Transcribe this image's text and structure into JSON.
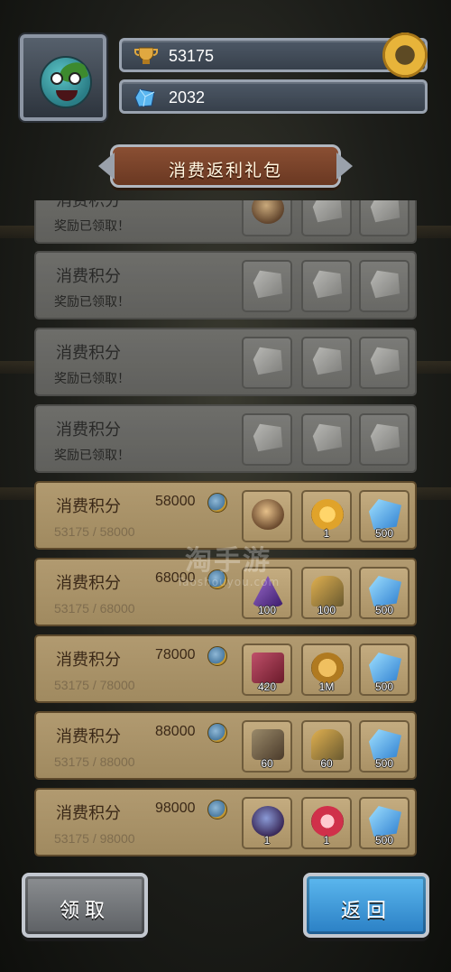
{
  "top": {
    "gold": "53175",
    "gems": "2032"
  },
  "banner": {
    "title": "消费返利礼包"
  },
  "list": {
    "rows": [
      {
        "name": "消费积分",
        "status": "奖励已领取！",
        "claimed": true,
        "items": [
          {
            "icon": "hero-icon",
            "count": ""
          },
          {
            "icon": "badge-icon",
            "count": ""
          },
          {
            "icon": "gem-icon",
            "count": ""
          }
        ]
      },
      {
        "name": "消费积分",
        "status": "奖励已领取！",
        "claimed": true,
        "items": [
          {
            "icon": "weapon-icon",
            "count": ""
          },
          {
            "icon": "tool-icon",
            "count": ""
          },
          {
            "icon": "gem-icon",
            "count": ""
          }
        ]
      },
      {
        "name": "消费积分",
        "status": "奖励已领取！",
        "claimed": true,
        "items": [
          {
            "icon": "hero-icon",
            "count": ""
          },
          {
            "icon": "badge-icon",
            "count": ""
          },
          {
            "icon": "gem-icon",
            "count": ""
          }
        ]
      },
      {
        "name": "消费积分",
        "status": "奖励已领取！",
        "claimed": true,
        "items": [
          {
            "icon": "tool-icon",
            "count": ""
          },
          {
            "icon": "wizard-hat-icon",
            "count": ""
          },
          {
            "icon": "gem-icon",
            "count": ""
          }
        ]
      },
      {
        "name": "消费积分",
        "points": "58000",
        "progress": "53175 / 58000",
        "claimed": false,
        "items": [
          {
            "icon": "hero-icon",
            "count": ""
          },
          {
            "icon": "fire-badge-icon",
            "count": "1"
          },
          {
            "icon": "gem-icon",
            "count": "500"
          }
        ]
      },
      {
        "name": "消费积分",
        "points": "68000",
        "progress": "53175 / 68000",
        "claimed": false,
        "items": [
          {
            "icon": "wizard-hat-icon",
            "count": "100"
          },
          {
            "icon": "helmet-icon",
            "count": "100"
          },
          {
            "icon": "gem-icon",
            "count": "500"
          }
        ]
      },
      {
        "name": "消费积分",
        "points": "78000",
        "progress": "53175 / 78000",
        "claimed": false,
        "items": [
          {
            "icon": "book-icon",
            "count": "420"
          },
          {
            "icon": "gold-coin-icon",
            "count": "1M"
          },
          {
            "icon": "gem-icon",
            "count": "500"
          }
        ]
      },
      {
        "name": "消费积分",
        "points": "88000",
        "progress": "53175 / 88000",
        "claimed": false,
        "items": [
          {
            "icon": "tool-icon",
            "count": "60"
          },
          {
            "icon": "helmet-icon",
            "count": "60"
          },
          {
            "icon": "gem-icon",
            "count": "500"
          }
        ]
      },
      {
        "name": "消费积分",
        "points": "98000",
        "progress": "53175 / 98000",
        "claimed": false,
        "items": [
          {
            "icon": "hero-icon",
            "count": "1"
          },
          {
            "icon": "red-badge-icon",
            "count": "1"
          },
          {
            "icon": "gem-icon",
            "count": "500"
          }
        ]
      }
    ]
  },
  "buttons": {
    "claim": "领取",
    "back": "返回"
  },
  "watermark": {
    "main": "淘手游",
    "sub": "Taoshouyou.com"
  }
}
